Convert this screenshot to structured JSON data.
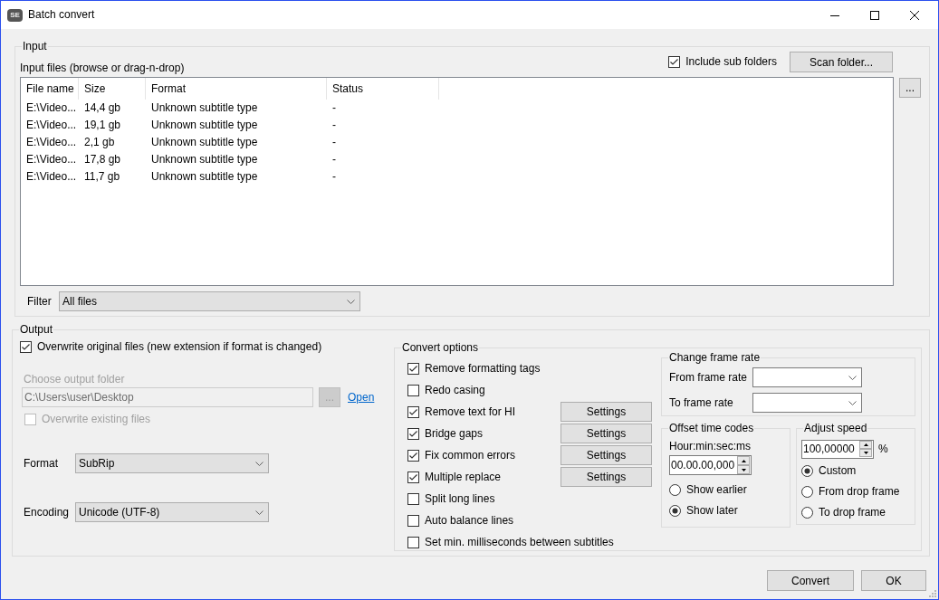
{
  "window": {
    "title": "Batch convert",
    "logo_text": "SE"
  },
  "input": {
    "title": "Input",
    "files_label": "Input files (browse or drag-n-drop)",
    "include_sub_folders": {
      "label": "Include sub folders",
      "checked": true
    },
    "scan_button": "Scan folder...",
    "browse_button": "...",
    "table": {
      "columns": [
        "File name",
        "Size",
        "Format",
        "Status"
      ],
      "rows": [
        [
          "E:\\Video...",
          "14,4 gb",
          "Unknown subtitle type",
          "-"
        ],
        [
          "E:\\Video...",
          "19,1 gb",
          "Unknown subtitle type",
          "-"
        ],
        [
          "E:\\Video...",
          "2,1 gb",
          "Unknown subtitle type",
          "-"
        ],
        [
          "E:\\Video...",
          "17,8 gb",
          "Unknown subtitle type",
          "-"
        ],
        [
          "E:\\Video...",
          "11,7 gb",
          "Unknown subtitle type",
          "-"
        ]
      ]
    },
    "filter": {
      "label": "Filter",
      "value": "All files"
    }
  },
  "output": {
    "title": "Output",
    "overwrite_original": {
      "label": "Overwrite original files (new extension if format is changed)",
      "checked": true
    },
    "output_folder": {
      "label": "Choose output folder",
      "value": "C:\\Users\\user\\Desktop",
      "disabled": true
    },
    "browse_button": {
      "label": "...",
      "disabled": true
    },
    "open_link": "Open",
    "overwrite_existing": {
      "label": "Overwrite existing files",
      "checked": false,
      "disabled": true
    },
    "format": {
      "label": "Format",
      "value": "SubRip"
    },
    "encoding": {
      "label": "Encoding",
      "value": "Unicode (UTF-8)"
    },
    "convert_options": {
      "title": "Convert options",
      "options": [
        {
          "label": "Remove formatting tags",
          "checked": true
        },
        {
          "label": "Redo casing",
          "checked": false
        },
        {
          "label": "Remove text for HI",
          "checked": true,
          "settings_button": "Settings"
        },
        {
          "label": "Bridge gaps",
          "checked": true,
          "settings_button": "Settings"
        },
        {
          "label": "Fix common errors",
          "checked": true,
          "settings_button": "Settings"
        },
        {
          "label": "Multiple replace",
          "checked": true,
          "settings_button": "Settings"
        },
        {
          "label": "Split long lines",
          "checked": false
        },
        {
          "label": "Auto balance lines",
          "checked": false
        },
        {
          "label": "Set min. milliseconds between subtitles",
          "checked": false
        }
      ],
      "change_frame_rate": {
        "title": "Change frame rate",
        "from_label": "From frame rate",
        "to_label": "To frame rate"
      },
      "offset_time_codes": {
        "title": "Offset time codes",
        "format_label": "Hour:min:sec:ms",
        "value": "00.00.00,000",
        "directions": [
          {
            "label": "Show earlier",
            "selected": false
          },
          {
            "label": "Show later",
            "selected": true
          }
        ]
      },
      "adjust_speed": {
        "title": "Adjust speed",
        "value": "100,00000",
        "unit": "%",
        "modes": [
          {
            "label": "Custom",
            "selected": true
          },
          {
            "label": "From drop frame",
            "selected": false
          },
          {
            "label": "To drop frame",
            "selected": false
          }
        ]
      }
    }
  },
  "buttons": [
    "Convert",
    "OK"
  ]
}
